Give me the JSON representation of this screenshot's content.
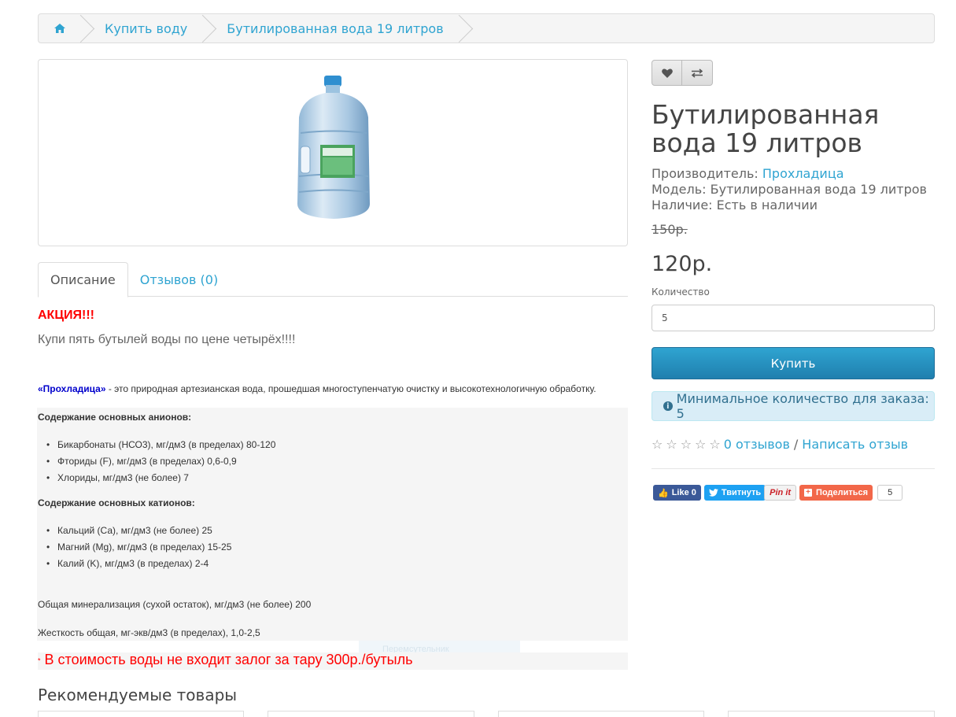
{
  "breadcrumb": {
    "items": [
      "Купить воду",
      "Бутилированная вода 19 литров"
    ]
  },
  "tabs": [
    "Описание",
    "Отзывов (0)"
  ],
  "description": {
    "promo_title": "АКЦИЯ!!!",
    "promo_text": "Купи пять бутылей воды по цене четырёх!!!!",
    "brand": "«Прохладица»",
    "intro": " - это природная артезианская вода, прошедшая многоступенчатую очистку и высокотехнологичную обработку.",
    "anions_title": "Содержание основных анионов:",
    "anions": [
      "Бикарбонаты (НСО3), мг/дм3 (в пределах) 80-120",
      "Фториды (F), мг/дм3 (в пределах) 0,6-0,9",
      "Хлориды, мг/дм3 (не более) 7"
    ],
    "cations_title": "Содержание основных катионов:",
    "cations": [
      "Кальций (Са), мг/дм3 (не более) 25",
      "Магний (Mg), мг/дм3 (в пределах) 15-25",
      "Калий (K), мг/дм3 (в пределах) 2-4"
    ],
    "mineralization": "Общая минерализация (сухой остаток), мг/дм3 (не более) 200",
    "hardness": "Жесткость общая, мг-экв/дм3 (в пределах), 1,0-2,5",
    "faded_text": "Перемсутельник",
    "deposit_star": "*",
    "deposit": "В стоимость воды не входит залог за тару 300р./бутыль"
  },
  "related": {
    "title": "Рекомендуемые товары"
  },
  "product": {
    "title": "Бутилированная вода 19 литров",
    "manufacturer_label": "Производитель:",
    "manufacturer": "Прохладица",
    "model": "Модель: Бутилированная вода 19 литров",
    "availability": "Наличие: Есть в наличии",
    "old_price": "150р.",
    "price": "120р.",
    "qty_label": "Количество",
    "qty_value": "5",
    "buy_label": "Купить",
    "min_qty_notice": "Минимальное количество для заказа: 5",
    "reviews_link": "0 отзывов",
    "write_review": "Написать отзыв",
    "rating": 0
  },
  "social": {
    "like": "Like 0",
    "tweet": "Твитнуть",
    "pin": "Pin it",
    "share": "Поделиться",
    "count": "5"
  },
  "colors": {
    "link": "#2fa4d1",
    "buy_button": "#2fa4d1",
    "promo": "#ff0000",
    "alert_bg": "#d9edf7"
  }
}
